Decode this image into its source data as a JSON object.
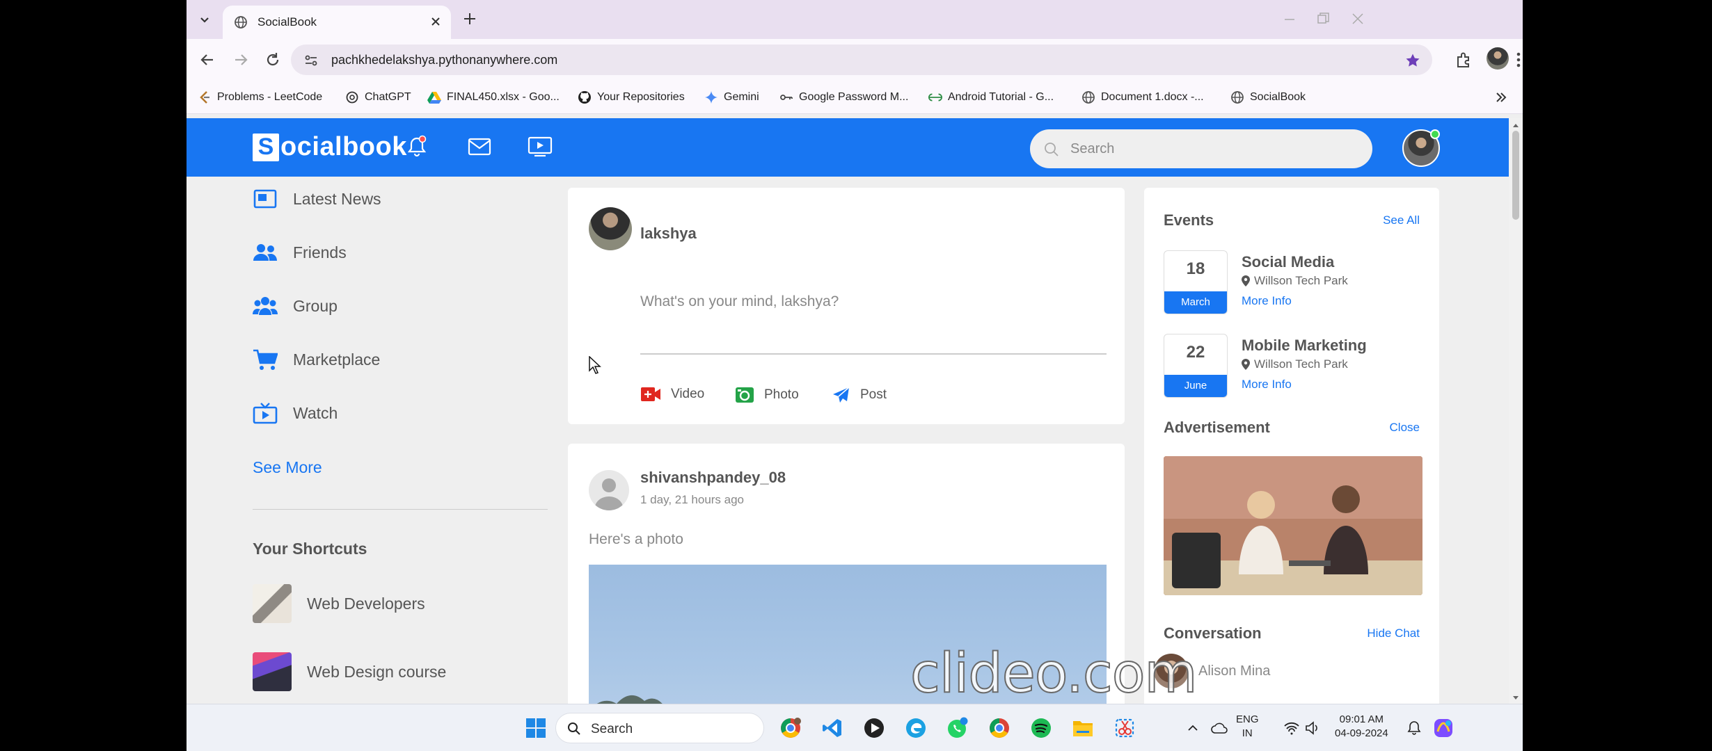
{
  "browser": {
    "tab_title": "SocialBook",
    "url": "pachkhedelakshya.pythonanywhere.com",
    "bookmarks": [
      {
        "label": "Problems - LeetCode",
        "icon": "leetcode-icon"
      },
      {
        "label": "ChatGPT",
        "icon": "chatgpt-icon"
      },
      {
        "label": "FINAL450.xlsx - Goo...",
        "icon": "google-drive-icon"
      },
      {
        "label": "Your Repositories",
        "icon": "github-icon"
      },
      {
        "label": "Gemini",
        "icon": "gemini-icon"
      },
      {
        "label": "Google Password M...",
        "icon": "key-icon"
      },
      {
        "label": "Android Tutorial - G...",
        "icon": "gfg-icon"
      },
      {
        "label": "Document 1.docx -...",
        "icon": "globe-icon"
      },
      {
        "label": "SocialBook",
        "icon": "globe-icon"
      }
    ]
  },
  "header": {
    "logo_initial": "S",
    "logo_rest": "ocialbook",
    "search_placeholder": "Search"
  },
  "nav": {
    "items": [
      {
        "label": "Latest News",
        "icon": "news-icon"
      },
      {
        "label": "Friends",
        "icon": "friends-icon"
      },
      {
        "label": "Group",
        "icon": "group-icon"
      },
      {
        "label": "Marketplace",
        "icon": "cart-icon"
      },
      {
        "label": "Watch",
        "icon": "tv-icon"
      }
    ],
    "see_more": "See More",
    "shortcuts_title": "Your Shortcuts",
    "shortcuts": [
      {
        "label": "Web Developers"
      },
      {
        "label": "Web Design course"
      }
    ]
  },
  "composer": {
    "user_name": "lakshya",
    "prompt": "What's on your mind, lakshya?",
    "actions": [
      {
        "label": "Video",
        "icon": "video-icon",
        "color": "#e0271f"
      },
      {
        "label": "Photo",
        "icon": "camera-icon",
        "color": "#24a348"
      },
      {
        "label": "Post",
        "icon": "send-icon",
        "color": "#1876f2"
      }
    ]
  },
  "post": {
    "user_name": "shivanshpandey_08",
    "time": "1 day, 21 hours ago",
    "caption": "Here's a photo"
  },
  "right": {
    "events_title": "Events",
    "see_all": "See All",
    "events": [
      {
        "day": "18",
        "month": "March",
        "title": "Social Media",
        "location": "Willson Tech Park",
        "more": "More Info"
      },
      {
        "day": "22",
        "month": "June",
        "title": "Mobile Marketing",
        "location": "Willson Tech Park",
        "more": "More Info"
      }
    ],
    "ad_title": "Advertisement",
    "ad_close": "Close",
    "conversation_title": "Conversation",
    "hide_chat": "Hide Chat",
    "chat_name": "Alison Mina"
  },
  "overlay": {
    "watermark": "clideo.com"
  },
  "taskbar": {
    "search_placeholder": "Search",
    "lang_top": "ENG",
    "lang_bottom": "IN",
    "time": "09:01 AM",
    "date": "04-09-2024"
  },
  "colors": {
    "brand": "#1876f2",
    "page_bg": "#efefef",
    "text": "#555555"
  }
}
